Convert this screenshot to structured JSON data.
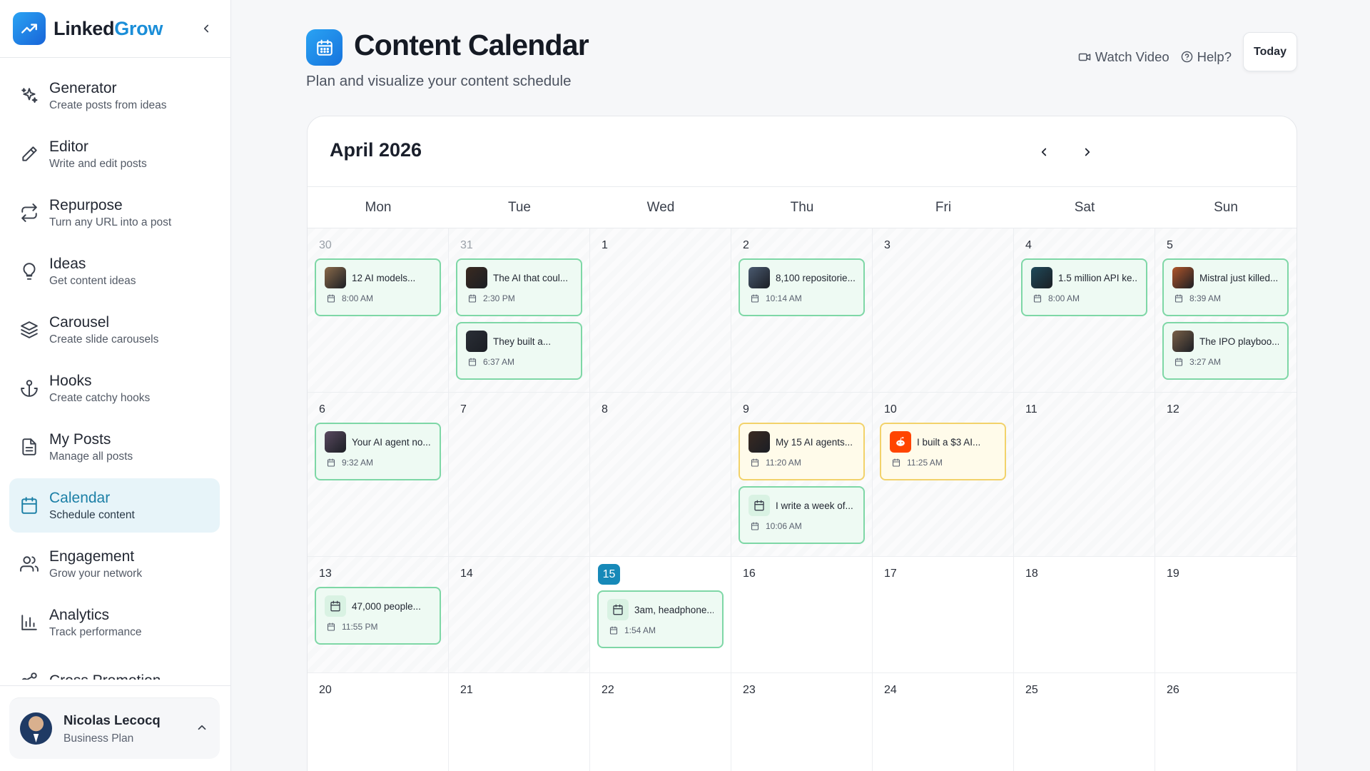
{
  "brand": {
    "name_part1": "Linked",
    "name_part2": "Grow"
  },
  "sidebar": {
    "items": [
      {
        "label": "Generator",
        "sub": "Create posts from ideas",
        "icon": "sparkles-icon"
      },
      {
        "label": "Editor",
        "sub": "Write and edit posts",
        "icon": "pencil-icon"
      },
      {
        "label": "Repurpose",
        "sub": "Turn any URL into a post",
        "icon": "repeat-icon"
      },
      {
        "label": "Ideas",
        "sub": "Get content ideas",
        "icon": "lightbulb-icon"
      },
      {
        "label": "Carousel",
        "sub": "Create slide carousels",
        "icon": "layers-icon"
      },
      {
        "label": "Hooks",
        "sub": "Create catchy hooks",
        "icon": "anchor-icon"
      },
      {
        "label": "My Posts",
        "sub": "Manage all posts",
        "icon": "file-text-icon"
      },
      {
        "label": "Calendar",
        "sub": "Schedule content",
        "icon": "calendar-icon",
        "active": true
      },
      {
        "label": "Engagement",
        "sub": "Grow your network",
        "icon": "users-icon"
      },
      {
        "label": "Analytics",
        "sub": "Track performance",
        "icon": "bar-chart-icon"
      },
      {
        "label": "Cross Promotion",
        "sub": "",
        "icon": "share-icon"
      }
    ]
  },
  "user": {
    "name": "Nicolas Lecocq",
    "plan": "Business Plan"
  },
  "header": {
    "title": "Content Calendar",
    "subtitle": "Plan and visualize your content schedule",
    "watch_video": "Watch Video",
    "help": "Help?",
    "today": "Today"
  },
  "calendar": {
    "month": "April 2026",
    "weekdays": [
      "Mon",
      "Tue",
      "Wed",
      "Thu",
      "Fri",
      "Sat",
      "Sun"
    ],
    "weeks": [
      {
        "days": [
          {
            "num": "30",
            "muted": true,
            "past": true,
            "posts": [
              {
                "title": "12 AI models...",
                "time": "8:00 AM",
                "status": "scheduled",
                "thumb": "#8a6a4a"
              }
            ]
          },
          {
            "num": "31",
            "muted": true,
            "past": true,
            "posts": [
              {
                "title": "The AI that coul...",
                "time": "2:30 PM",
                "status": "scheduled",
                "thumb": "#3a2a20"
              },
              {
                "title": "They built a...",
                "time": "6:37 AM",
                "status": "scheduled",
                "thumb": "#2a2e36"
              }
            ]
          },
          {
            "num": "1",
            "past": true,
            "posts": []
          },
          {
            "num": "2",
            "past": true,
            "posts": [
              {
                "title": "8,100 repositorie...",
                "time": "10:14 AM",
                "status": "scheduled",
                "thumb": "#4a5a70"
              }
            ]
          },
          {
            "num": "3",
            "past": true,
            "posts": []
          },
          {
            "num": "4",
            "past": true,
            "posts": [
              {
                "title": "1.5 million API ke...",
                "time": "8:00 AM",
                "status": "scheduled",
                "thumb": "#1f4a5a"
              }
            ]
          },
          {
            "num": "5",
            "past": true,
            "posts": [
              {
                "title": "Mistral just killed...",
                "time": "8:39 AM",
                "status": "scheduled",
                "thumb": "#b0552a"
              },
              {
                "title": "The IPO playboo...",
                "time": "3:27 AM",
                "status": "scheduled",
                "thumb": "#7a6048"
              }
            ]
          }
        ]
      },
      {
        "days": [
          {
            "num": "6",
            "past": true,
            "posts": [
              {
                "title": "Your AI agent no...",
                "time": "9:32 AM",
                "status": "scheduled",
                "thumb": "#5a4a60"
              }
            ]
          },
          {
            "num": "7",
            "past": true,
            "posts": []
          },
          {
            "num": "8",
            "past": true,
            "posts": []
          },
          {
            "num": "9",
            "past": true,
            "posts": [
              {
                "title": "My 15 AI agents...",
                "time": "11:20 AM",
                "status": "draft",
                "thumb": "#3a2a22"
              },
              {
                "title": "I write a week of...",
                "time": "10:06 AM",
                "status": "scheduled",
                "thumb": "calendar"
              }
            ]
          },
          {
            "num": "10",
            "past": true,
            "posts": [
              {
                "title": "I built a $3 AI...",
                "time": "11:25 AM",
                "status": "draft",
                "thumb": "reddit"
              }
            ]
          },
          {
            "num": "11",
            "past": true,
            "posts": []
          },
          {
            "num": "12",
            "past": true,
            "posts": []
          }
        ]
      },
      {
        "days": [
          {
            "num": "13",
            "past": true,
            "posts": [
              {
                "title": "47,000 people...",
                "time": "11:55 PM",
                "status": "scheduled",
                "thumb": "calendar"
              }
            ]
          },
          {
            "num": "14",
            "past": true,
            "posts": []
          },
          {
            "num": "15",
            "today": true,
            "posts": [
              {
                "title": "3am, headphone...",
                "time": "1:54 AM",
                "status": "scheduled",
                "thumb": "calendar"
              }
            ]
          },
          {
            "num": "16",
            "posts": []
          },
          {
            "num": "17",
            "posts": []
          },
          {
            "num": "18",
            "posts": []
          },
          {
            "num": "19",
            "posts": []
          }
        ]
      },
      {
        "days": [
          {
            "num": "20",
            "posts": []
          },
          {
            "num": "21",
            "posts": []
          },
          {
            "num": "22",
            "posts": []
          },
          {
            "num": "23",
            "posts": []
          },
          {
            "num": "24",
            "posts": []
          },
          {
            "num": "25",
            "posts": []
          },
          {
            "num": "26",
            "posts": []
          }
        ]
      }
    ]
  },
  "colors": {
    "accent": "#1b8ed8",
    "active_bg": "#e7f4f9",
    "scheduled_border": "#7ed7a6",
    "draft_border": "#f2d26a",
    "today": "#1789b8"
  }
}
